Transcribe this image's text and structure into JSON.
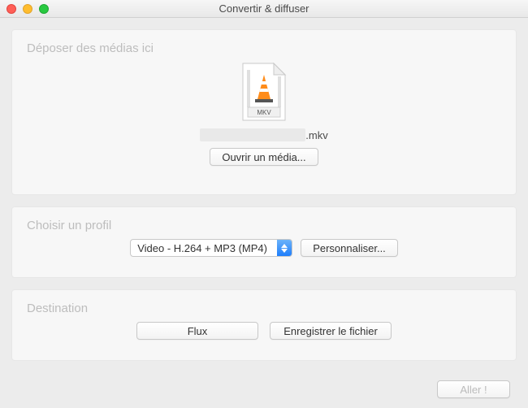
{
  "window": {
    "title": "Convertir & diffuser"
  },
  "drop": {
    "section_title": "Déposer des médias ici",
    "file_icon_badge": "MKV",
    "file_ext": ".mkv",
    "open_button": "Ouvrir un média..."
  },
  "profile": {
    "section_title": "Choisir un profil",
    "selected": "Video - H.264 + MP3 (MP4)",
    "customize_button": "Personnaliser..."
  },
  "destination": {
    "section_title": "Destination",
    "stream_button": "Flux",
    "save_button": "Enregistrer le fichier"
  },
  "footer": {
    "go_button": "Aller !"
  }
}
